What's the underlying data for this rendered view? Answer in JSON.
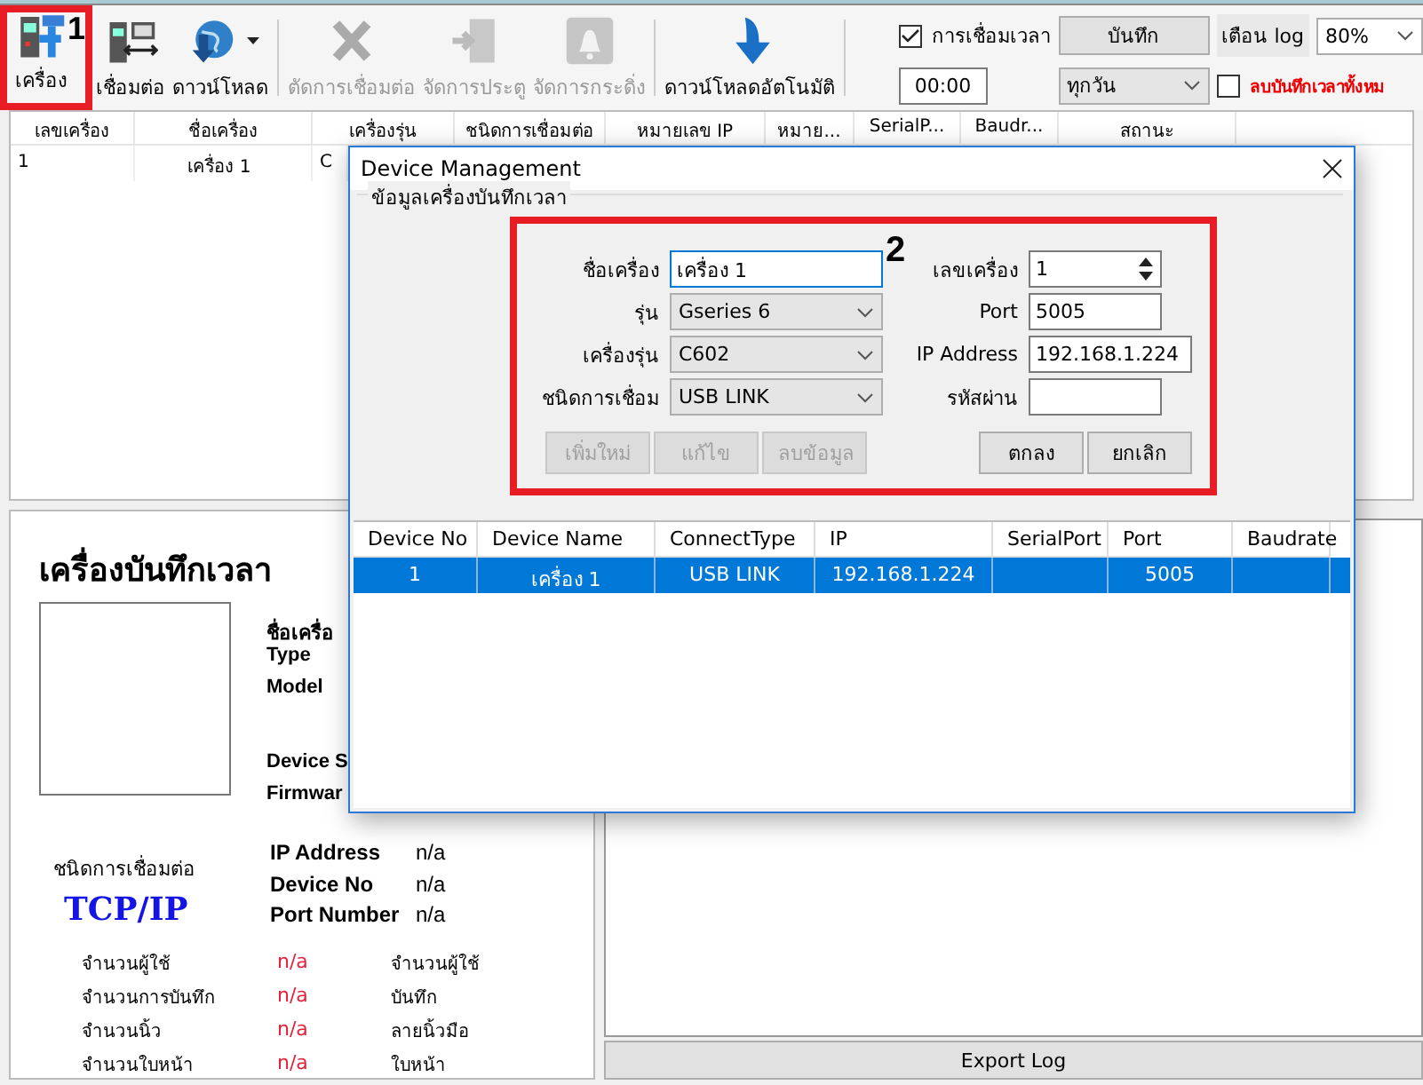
{
  "toolbar": {
    "buttons": [
      {
        "label": "เครื่อง",
        "disabled": false,
        "dropdown": false,
        "annotation": "1"
      },
      {
        "label": "เชื่อมต่อ",
        "disabled": false,
        "dropdown": false
      },
      {
        "label": "ดาวน์โหลด",
        "disabled": false,
        "dropdown": true
      },
      {
        "label": "ตัดการเชื่อมต่อ",
        "disabled": true,
        "dropdown": false
      },
      {
        "label": "จัดการประตู",
        "disabled": true,
        "dropdown": false
      },
      {
        "label": "จัดการกระดิ่ง",
        "disabled": true,
        "dropdown": false
      },
      {
        "label": "ดาวน์โหลดอัตโนมัติ",
        "disabled": false,
        "dropdown": false
      }
    ],
    "sync_checkbox": {
      "label": "การเชื่อมเวลา",
      "checked": true
    },
    "save_button": "บันทึก",
    "log_label": "เตือน log",
    "log_select": "80%",
    "time_field": "00:00",
    "day_select": "ทุกวัน",
    "delete_checkbox": {
      "label": "ลบบันทึกเวลาทั้งหม",
      "checked": false
    }
  },
  "device_table": {
    "columns": [
      "เลขเครื่อง",
      "ชื่อเครื่อง",
      "เครื่องรุ่น",
      "ชนิดการเชื่อมต่อ",
      "หมายเลข IP",
      "หมาย...",
      "SerialP...",
      "Baudr...",
      "สถานะ"
    ],
    "rows": [
      [
        "1",
        "เครื่อง 1",
        "C"
      ]
    ]
  },
  "device_panel": {
    "title": "เครื่องบันทึกเวลา",
    "info_labels": [
      "ชื่อเครื่อ",
      "Type",
      "Model",
      "Device S",
      "Firmwar"
    ],
    "connection_label": "ชนิดการเชื่อมต่อ",
    "connection_type": "TCP/IP",
    "connection_info": [
      {
        "label": "IP Address",
        "value": "n/a"
      },
      {
        "label": "Device No",
        "value": "n/a"
      },
      {
        "label": "Port Number",
        "value": "n/a"
      }
    ],
    "stats": [
      {
        "label": "จำนวนผู้ใช้",
        "value": "n/a",
        "unit": "จำนวนผู้ใช้"
      },
      {
        "label": "จำนวนการบันทึก",
        "value": "n/a",
        "unit": "บันทึก"
      },
      {
        "label": "จำนวนนิ้ว",
        "value": "n/a",
        "unit": "ลายนิ้วมือ"
      },
      {
        "label": "จำนวนใบหน้า",
        "value": "n/a",
        "unit": "ใบหน้า"
      }
    ]
  },
  "export_button": "Export Log",
  "dialog": {
    "title": "Device Management",
    "group_title": "ข้อมูลเครื่องบันทึกเวลา",
    "annotation": "2",
    "left_fields": [
      {
        "label": "ชื่อเครื่อง",
        "kind": "text",
        "value": "เครื่อง 1",
        "focused": true
      },
      {
        "label": "รุ่น",
        "kind": "select",
        "value": "Gseries 6"
      },
      {
        "label": "เครื่องรุ่น",
        "kind": "select",
        "value": "C602"
      },
      {
        "label": "ชนิดการเชื่อม",
        "kind": "select",
        "value": "USB LINK"
      }
    ],
    "right_fields": [
      {
        "label": "เลขเครื่อง",
        "kind": "spin",
        "value": "1"
      },
      {
        "label": "Port",
        "kind": "text",
        "value": "5005"
      },
      {
        "label": "IP Address",
        "kind": "wide",
        "value": "192.168.1.224"
      },
      {
        "label": "รหัสผ่าน",
        "kind": "text"
      }
    ],
    "edit_buttons": [
      {
        "label": "เพิ่มใหม่",
        "disabled": true
      },
      {
        "label": "แก้ไข",
        "disabled": true
      },
      {
        "label": "ลบข้อมูล",
        "disabled": true
      }
    ],
    "ok_button": "ตกลง",
    "cancel_button": "ยกเลิก",
    "grid": {
      "columns": [
        "Device No",
        "Device Name",
        "ConnectType",
        "IP",
        "SerialPort",
        "Port",
        "Baudrate"
      ],
      "rows": [
        {
          "cells": [
            "1",
            "เครื่อง 1",
            "USB LINK",
            "192.168.1.224",
            "",
            "5005",
            ""
          ],
          "selected": true
        }
      ]
    }
  }
}
